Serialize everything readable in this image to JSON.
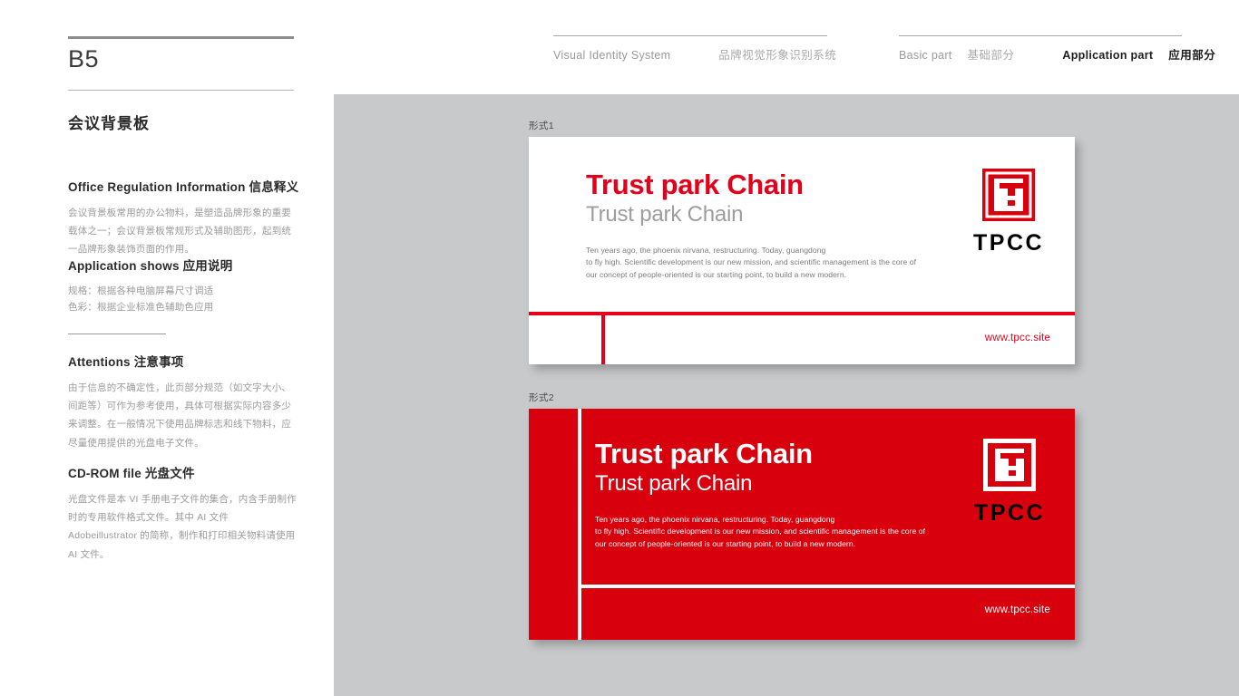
{
  "page": {
    "code": "B5",
    "section_title": "会议背景板"
  },
  "header": {
    "left": {
      "en": "Visual Identity System",
      "cn": "品牌视觉形象识别系统"
    },
    "right": {
      "basic_en": "Basic part",
      "basic_cn": "基础部分",
      "application_en": "Application part",
      "application_cn": "应用部分"
    }
  },
  "sidebar": {
    "blocks": [
      {
        "heading": "Office Regulation Information 信息释义",
        "body": "会议背景板常用的办公物料，是塑造品牌形象的重要载体之一；会议背景板常规形式及辅助图形，起到统一品牌形象装饰页面的作用。"
      },
      {
        "heading": "Application shows 应用说明",
        "body": "规格：根据各种电脑屏幕尺寸调适\n色彩：根据企业标准色辅助色应用"
      },
      {
        "heading": "Attentions 注意事项",
        "body": "由于信息的不确定性，此页部分规范（如文字大小、间距等）可作为参考使用，具体可根据实际内容多少来调整。在一般情况下使用品牌标志和线下物料，应尽量使用提供的光盘电子文件。"
      },
      {
        "heading": "CD-ROM file 光盘文件",
        "body": "光盘文件是本 VI 手册电子文件的集合，内含手册制作时的专用软件格式文件。其中 AI 文件 Adobeillustrator 的简称，制作和打印相关物料请使用 AI 文件。"
      }
    ]
  },
  "panels": [
    {
      "label": "形式1",
      "brand_main": "Trust park Chain",
      "brand_sub": "Trust park Chain",
      "body": "Ten years ago, the phoenix nirvana, restructuring. Today, guangdong\nto fly high. Scientific development is our new mission,  and scientific management is the core of\nour concept of people-oriented is our starting point, to build a new modern.",
      "logo_word": "TPCC",
      "url": "www.tpcc.site"
    },
    {
      "label": "形式2",
      "brand_main": "Trust park Chain",
      "brand_sub": "Trust park Chain",
      "body": "Ten years ago, the phoenix nirvana, restructuring. Today, guangdong\nto fly high. Scientific development is our new mission,  and scientific management is the core of\nour concept of people-oriented is our starting point, to build a new modern.",
      "logo_word": "TPCC",
      "url": "www.tpcc.site"
    }
  ],
  "colors": {
    "brand_red": "#e4001b",
    "panel_red": "#d9000d",
    "canvas_gray": "#c8c9ca",
    "muted_text": "#9b9b9b"
  }
}
